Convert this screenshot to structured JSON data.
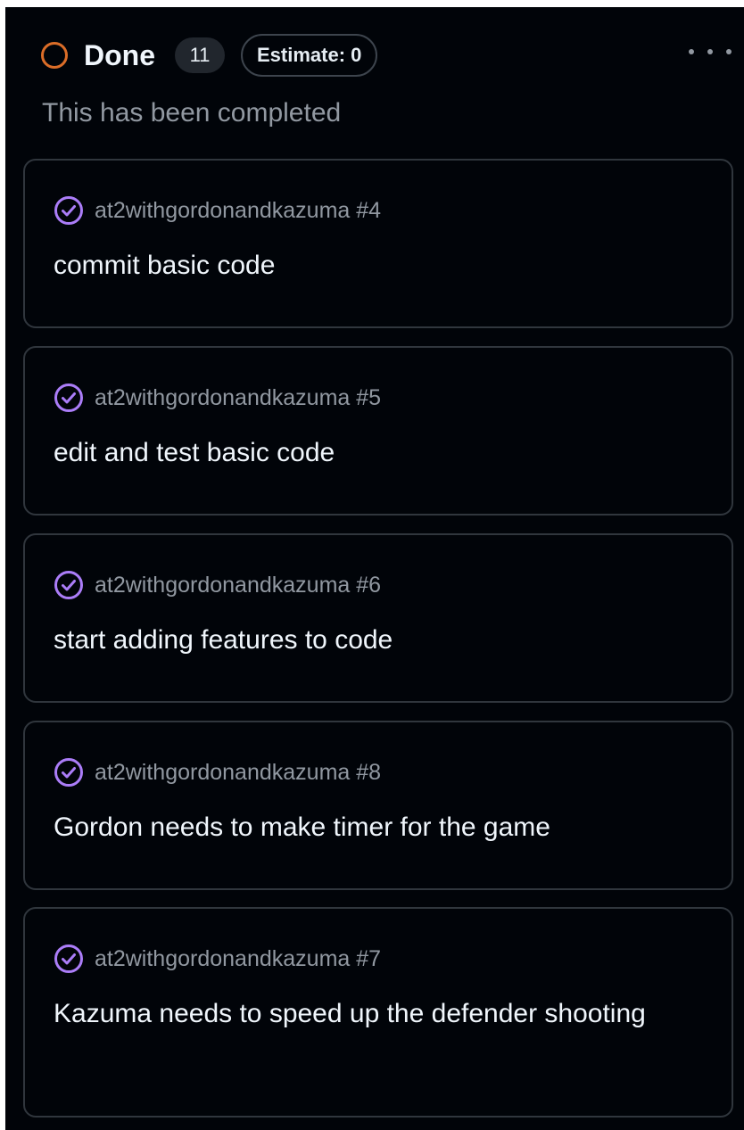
{
  "column": {
    "title": "Done",
    "count": "11",
    "estimate": "Estimate: 0",
    "description": "This has been completed",
    "status_color": "#db6d28"
  },
  "icons": {
    "status": "circle-status-icon",
    "issue": "check-circle-icon",
    "more": "kebab-horizontal-icon"
  },
  "colors": {
    "background": "#010409",
    "card_border": "#30363d",
    "issue_closed": "#ab7df8",
    "muted_text": "#9198a1"
  },
  "cards": [
    {
      "repo": "at2withgordonandkazuma #4",
      "title": "commit basic code"
    },
    {
      "repo": "at2withgordonandkazuma #5",
      "title": "edit and test basic code"
    },
    {
      "repo": "at2withgordonandkazuma #6",
      "title": "start adding features to code"
    },
    {
      "repo": "at2withgordonandkazuma #8",
      "title": "Gordon needs to make timer for the game"
    },
    {
      "repo": "at2withgordonandkazuma #7",
      "title": "Kazuma needs to speed up the defender shooting"
    }
  ]
}
